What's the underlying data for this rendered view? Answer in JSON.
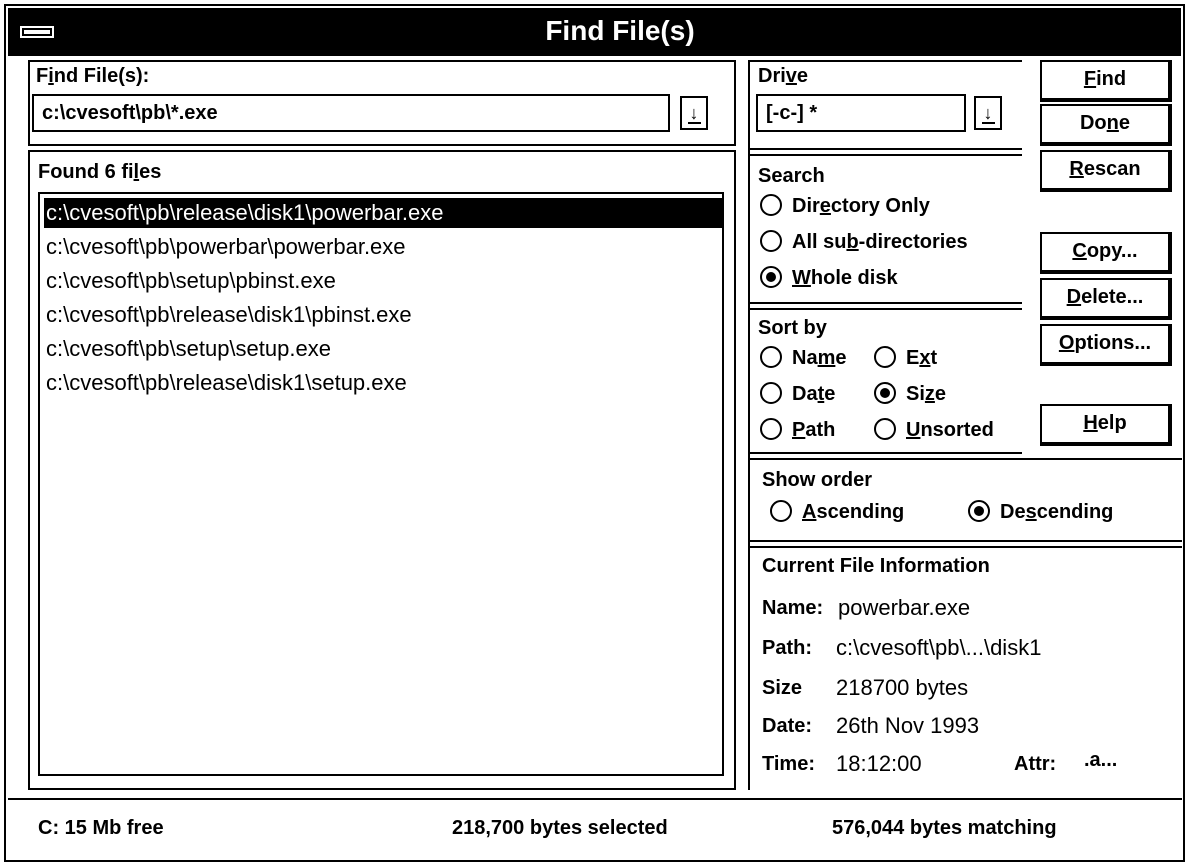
{
  "window": {
    "title": "Find File(s)"
  },
  "find": {
    "label_pre": "F",
    "label_u": "i",
    "label_post": "nd File(s):",
    "value": "c:\\cvesoft\\pb\\*.exe",
    "dropdown_glyph": "↓"
  },
  "drive": {
    "label_pre": "Dri",
    "label_u": "v",
    "label_post": "e",
    "value": "[-c-]  *",
    "dropdown_glyph": "↓"
  },
  "buttons": {
    "find": {
      "u": "F",
      "rest": "ind"
    },
    "done": {
      "pre": "Do",
      "u": "n",
      "rest": "e"
    },
    "rescan": {
      "u": "R",
      "rest": "escan"
    },
    "copy": {
      "u": "C",
      "rest": "opy..."
    },
    "delete": {
      "u": "D",
      "rest": "elete..."
    },
    "options": {
      "u": "O",
      "rest": "ptions..."
    },
    "help": {
      "u": "H",
      "rest": "elp"
    }
  },
  "found": {
    "label_pre": "Found 6 fi",
    "label_u": "l",
    "label_post": "es",
    "files": [
      "c:\\cvesoft\\pb\\release\\disk1\\powerbar.exe",
      "c:\\cvesoft\\pb\\powerbar\\powerbar.exe",
      "c:\\cvesoft\\pb\\setup\\pbinst.exe",
      "c:\\cvesoft\\pb\\release\\disk1\\pbinst.exe",
      "c:\\cvesoft\\pb\\setup\\setup.exe",
      "c:\\cvesoft\\pb\\release\\disk1\\setup.exe"
    ],
    "selected_index": 0
  },
  "search": {
    "title": "Search",
    "options": [
      {
        "pre": "Dir",
        "u": "e",
        "post": "ctory Only",
        "selected": false
      },
      {
        "pre": "All su",
        "u": "b",
        "post": "-directories",
        "selected": false
      },
      {
        "pre": "",
        "u": "W",
        "post": "hole disk",
        "selected": true
      }
    ]
  },
  "sort": {
    "title": "Sort by",
    "options": [
      {
        "pre": "Na",
        "u": "m",
        "post": "e",
        "selected": false
      },
      {
        "pre": "E",
        "u": "x",
        "post": "t",
        "selected": false
      },
      {
        "pre": "Da",
        "u": "t",
        "post": "e",
        "selected": false
      },
      {
        "pre": "Si",
        "u": "z",
        "post": "e",
        "selected": true
      },
      {
        "pre": "",
        "u": "P",
        "post": "ath",
        "selected": false
      },
      {
        "pre": "",
        "u": "U",
        "post": "nsorted",
        "selected": false
      }
    ]
  },
  "show_order": {
    "title": "Show order",
    "options": [
      {
        "pre": "",
        "u": "A",
        "post": "scending",
        "selected": false
      },
      {
        "pre": "De",
        "u": "s",
        "post": "cending",
        "selected": true
      }
    ]
  },
  "info": {
    "title": "Current File Information",
    "name_label": "Name:",
    "name_value": "powerbar.exe",
    "path_label": "Path:",
    "path_value": "c:\\cvesoft\\pb\\...\\disk1",
    "size_label": "Size",
    "size_value": "218700 bytes",
    "date_label": "Date:",
    "date_value": "26th Nov 1993",
    "time_label": "Time:",
    "time_value": "18:12:00",
    "attr_label": "Attr:",
    "attr_value": ".a..."
  },
  "status": {
    "free": "C: 15 Mb free",
    "selected": "218,700 bytes selected",
    "matching": "576,044 bytes matching"
  }
}
